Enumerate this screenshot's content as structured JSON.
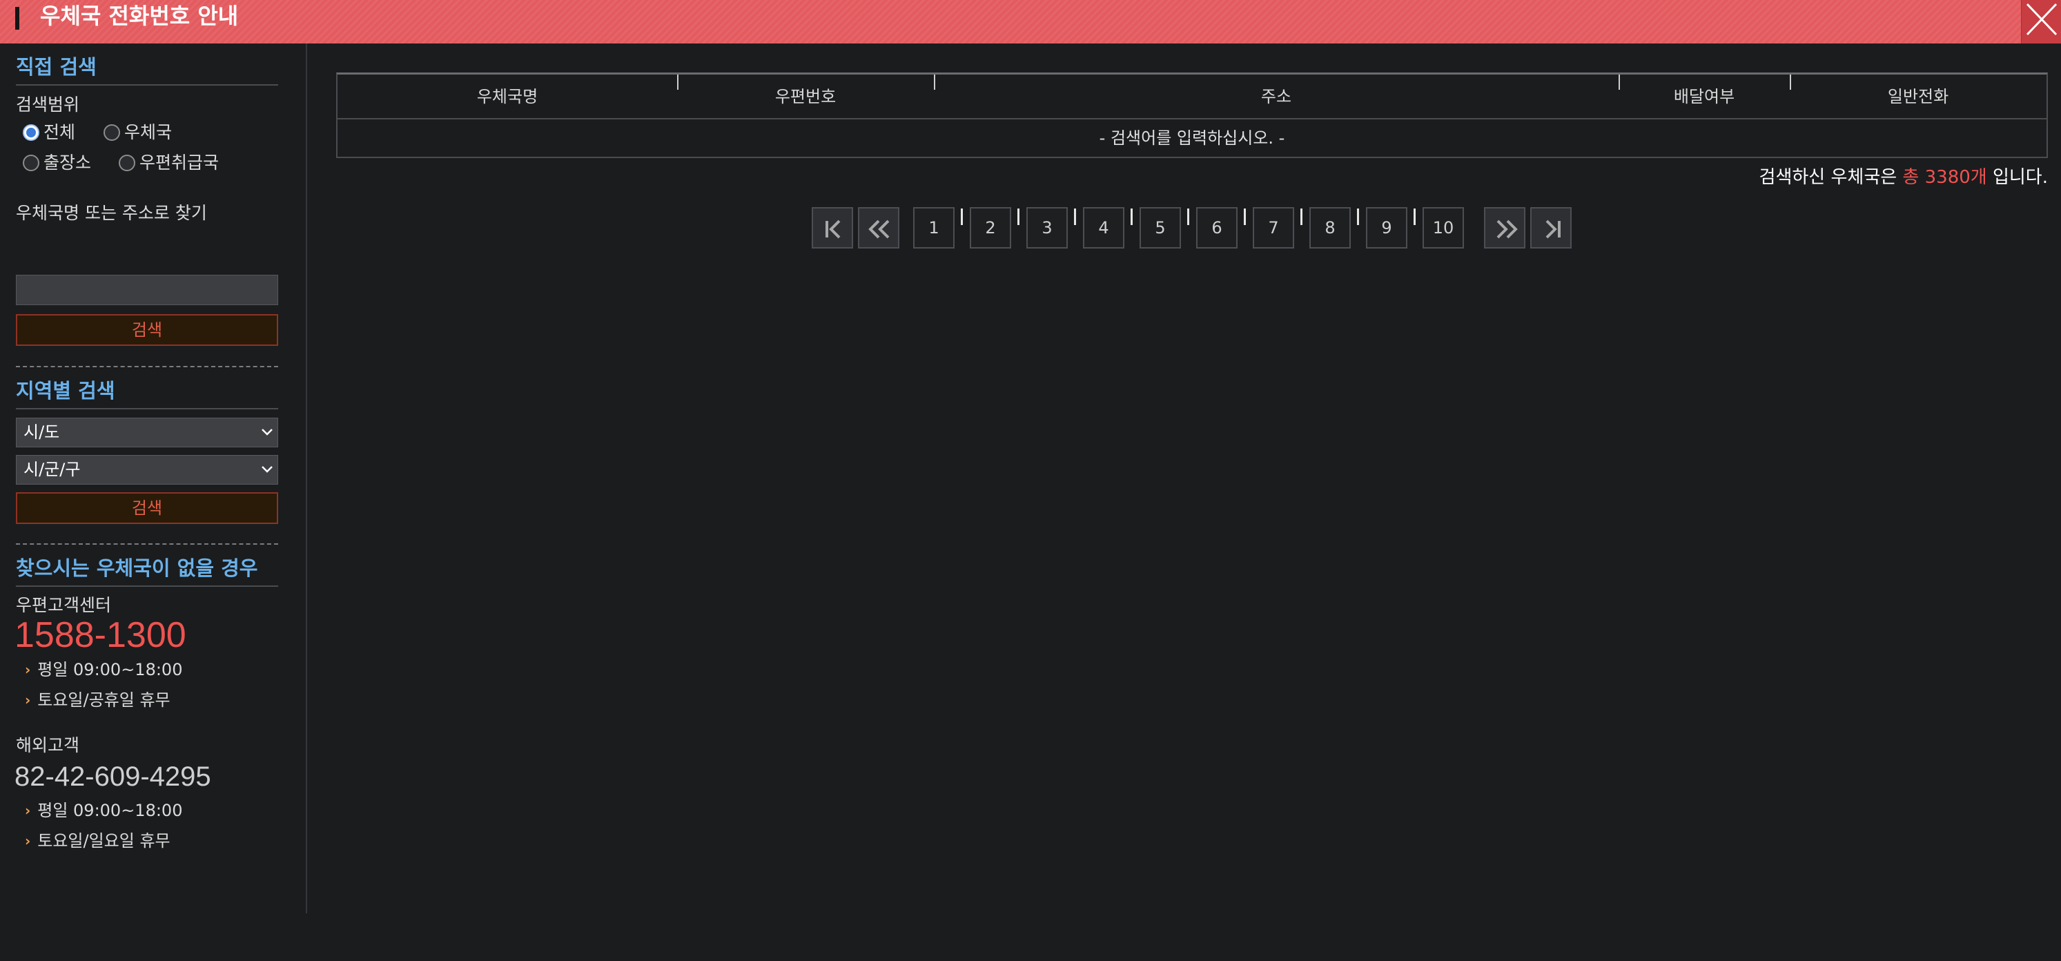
{
  "header": {
    "title": "우체국 전화번호 안내"
  },
  "direct_search": {
    "title": "직접 검색",
    "range_label": "검색범위",
    "radios": [
      "전체",
      "우체국",
      "출장소",
      "우편취급국"
    ],
    "selected": "전체",
    "keyword_label": "우체국명 또는 주소로 찾기",
    "keyword_value": "",
    "search_label": "검색"
  },
  "region_search": {
    "title": "지역별 검색",
    "sido": "시/도",
    "sigungu": "시/군/구",
    "search_label": "검색"
  },
  "help": {
    "title": "찾으시는 우체국이 없을 경우",
    "domestic": {
      "label": "우편고객센터",
      "phone": "1588-1300",
      "hours": "평일 09:00~18:00",
      "closed": "토요일/공휴일 휴무"
    },
    "overseas": {
      "label": "해외고객",
      "phone": "82-42-609-4295",
      "hours": "평일 09:00~18:00",
      "closed": "토요일/일요일 휴무"
    }
  },
  "table": {
    "columns": [
      "우체국명",
      "우편번호",
      "주소",
      "배달여부",
      "일반전화"
    ],
    "empty_message": "- 검색어를 입력하십시오. -"
  },
  "total": {
    "prefix": "검색하신 우체국은 ",
    "count": "총 3380개",
    "suffix": " 입니다."
  },
  "pagination": {
    "pages": [
      "1",
      "2",
      "3",
      "4",
      "5",
      "6",
      "7",
      "8",
      "9",
      "10"
    ]
  },
  "colors": {
    "header_bg": "#e35b5f",
    "accent_blue": "#6ab1ea",
    "accent_red": "#ef5350"
  }
}
